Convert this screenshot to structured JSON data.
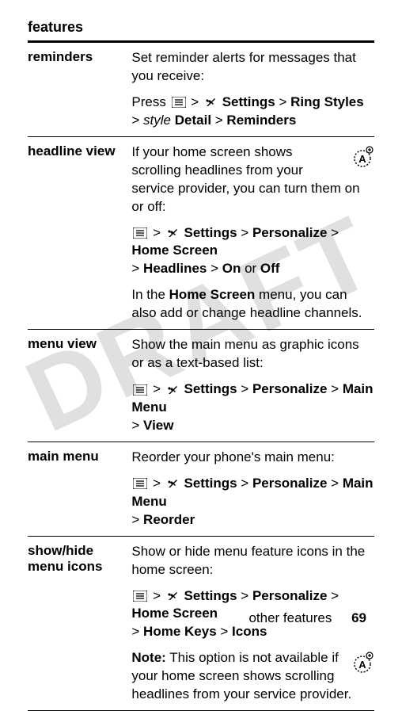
{
  "watermark": "DRAFT",
  "table": {
    "header": "features",
    "rows": [
      {
        "label": "reminders",
        "para1": "Set reminder alerts for messages that you receive:",
        "path": {
          "prefix": "Press ",
          "settings": "Settings",
          "sep": " > ",
          "ring": "Ring Styles",
          "style": "style",
          "detail": "Detail",
          "rem": "Reminders"
        }
      },
      {
        "label": "headline view",
        "para1": "If your home screen shows scrolling headlines from your service provider, you can turn them on or off:",
        "path": {
          "settings": "Settings",
          "sep": " > ",
          "personalize": "Personalize",
          "home": "Home Screen",
          "headlines": "Headlines",
          "on": "On",
          "or": " or ",
          "off": "Off"
        },
        "para2a": "In the ",
        "para2b": "Home Screen",
        "para2c": " menu, you can also add or change headline channels."
      },
      {
        "label": "menu view",
        "para1": "Show the main menu as graphic icons or as a text-based list:",
        "path": {
          "settings": "Settings",
          "sep": " > ",
          "personalize": "Personalize",
          "mainmenu": "Main Menu",
          "view": "View"
        }
      },
      {
        "label": "main menu",
        "para1": "Reorder your phone's main menu:",
        "path": {
          "settings": "Settings",
          "sep": " > ",
          "personalize": "Personalize",
          "mainmenu": "Main Menu",
          "reorder": "Reorder"
        }
      },
      {
        "label": "show/hide menu icons",
        "para1": "Show or hide menu feature icons in the home screen:",
        "path": {
          "settings": "Settings",
          "sep": " > ",
          "personalize": "Personalize",
          "home": "Home Screen",
          "homekeys": "Home Keys",
          "icons": "Icons"
        },
        "noteLabel": "Note:",
        "noteText": " This option is not available if your home screen shows scrolling headlines from your service provider."
      }
    ]
  },
  "footer": {
    "text": "other features",
    "page": "69"
  }
}
